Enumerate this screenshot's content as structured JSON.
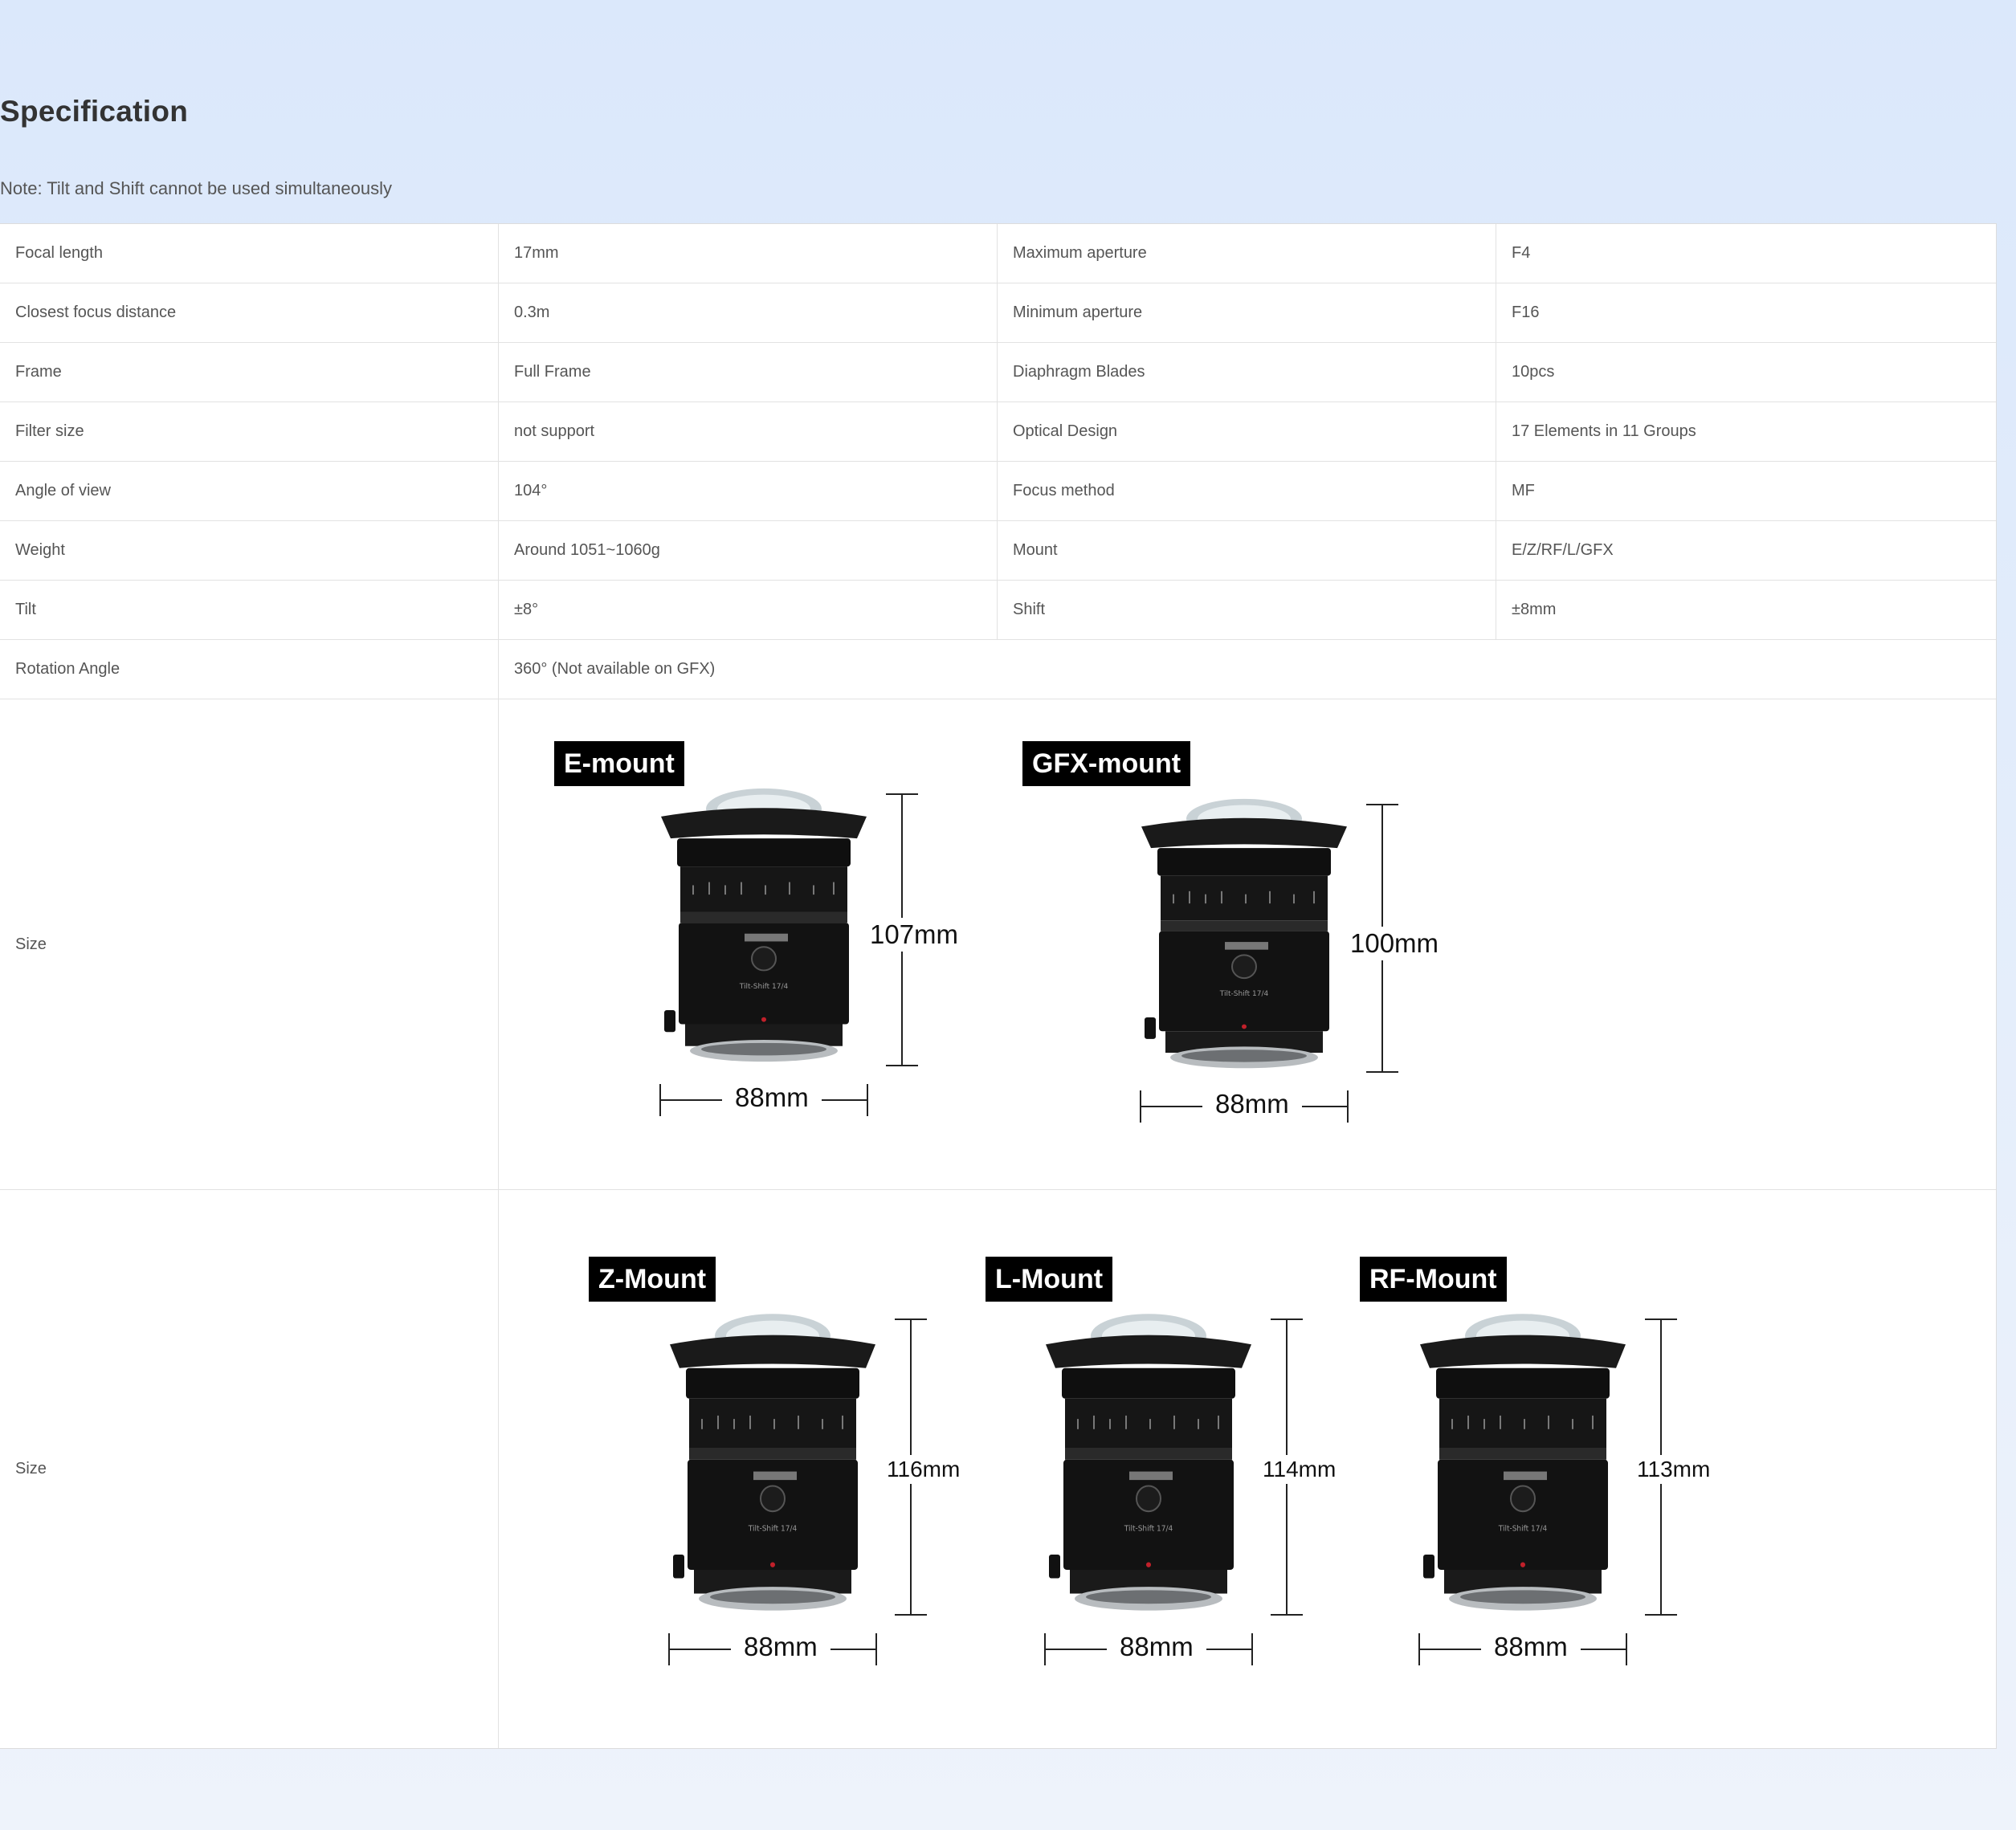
{
  "page": {
    "title": "Specification",
    "note": "Note: Tilt and Shift cannot be used simultaneously"
  },
  "specs": [
    {
      "label1": "Focal length",
      "value1": "17mm",
      "label2": "Maximum aperture",
      "value2": "F4"
    },
    {
      "label1": "Closest focus distance",
      "value1": "0.3m",
      "label2": "Minimum aperture",
      "value2": "F16"
    },
    {
      "label1": "Frame",
      "value1": "Full Frame",
      "label2": "Diaphragm Blades",
      "value2": "10pcs"
    },
    {
      "label1": "Filter size",
      "value1": "not support",
      "label2": "Optical Design",
      "value2": "17 Elements in 11 Groups"
    },
    {
      "label1": "Angle of view",
      "value1": "104°",
      "label2": "Focus method",
      "value2": "MF"
    },
    {
      "label1": "Weight",
      "value1": "Around 1051~1060g",
      "label2": "Mount",
      "value2": "E/Z/RF/L/GFX"
    },
    {
      "label1": "Tilt",
      "value1": "±8°",
      "label2": "Shift",
      "value2": "±8mm"
    }
  ],
  "rotation": {
    "label": "Rotation Angle",
    "value": "360°  (Not available on GFX)"
  },
  "size_rows": [
    {
      "label": "Size",
      "mounts": [
        {
          "name": "E-mount",
          "height": "107mm",
          "width": "88mm"
        },
        {
          "name": "GFX-mount",
          "height": "100mm",
          "width": "88mm"
        }
      ]
    },
    {
      "label": "Size",
      "mounts": [
        {
          "name": "Z-Mount",
          "height": "116mm",
          "width": "88mm"
        },
        {
          "name": "L-Mount",
          "height": "114mm",
          "width": "88mm"
        },
        {
          "name": "RF-Mount",
          "height": "113mm",
          "width": "88mm"
        }
      ]
    }
  ],
  "lens_engraving": "Tilt-Shift 17/4"
}
